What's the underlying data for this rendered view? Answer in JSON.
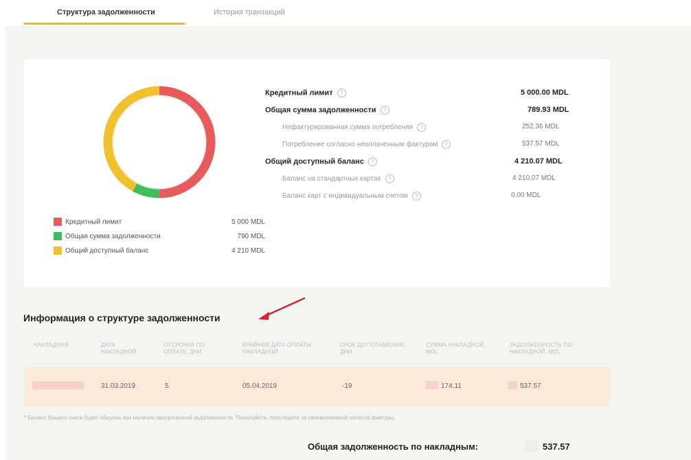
{
  "tabs": [
    {
      "label": "Структура задолженности",
      "active": true
    },
    {
      "label": "История транзакций",
      "active": false
    }
  ],
  "chart_data": {
    "type": "pie",
    "categories": [
      "Кредитный лимит",
      "Общая сумма задолженности",
      "Общий доступный баланс"
    ],
    "values": [
      5000,
      790,
      4210
    ],
    "colors": [
      "#e85b5d",
      "#3fbf5b",
      "#f0c12f"
    ]
  },
  "legend": [
    {
      "label": "Кредитный лимит",
      "value": "5 000 MDL",
      "color": "#e85b5d"
    },
    {
      "label": "Общая сумма задолженности",
      "value": "790 MDL",
      "color": "#3fbf5b"
    },
    {
      "label": "Общий доступный баланс",
      "value": "4 210 MDL",
      "color": "#f0c12f"
    }
  ],
  "summary": [
    {
      "label": "Кредитный лимит",
      "value": "5 000.00 MDL",
      "kind": "main"
    },
    {
      "label": "Общая сумма задолженности",
      "value": "789.93 MDL",
      "kind": "main"
    },
    {
      "label": "Нефактурированная сумма потребления",
      "value": "252.36 MDL",
      "kind": "sub"
    },
    {
      "label": "Потребление согласно неоплаченным фактурам",
      "value": "537.57 MDL",
      "kind": "sub"
    },
    {
      "label": "Общий доступный баланс",
      "value": "4 210.07 MDL",
      "kind": "main"
    },
    {
      "label": "Баланс на стандартных картах",
      "value": "4 210.07 MDL",
      "kind": "sub"
    },
    {
      "label": "Баланс карт с индивидуальным счетом",
      "value": "0.00 MDL",
      "kind": "sub"
    }
  ],
  "section_title": "Информация о структуре задолженности",
  "table": {
    "headers": [
      "НАКЛАДНАЯ",
      "ДАТА НАКЛАДНОЙ",
      "ОТСРОЧКА ПО ОПЛАТЕ, ДНИ",
      "КРАЙНЯЯ ДАТА ОПЛАТЫ НАКЛАДНОЙ",
      "СРОК ДО ПОГАШЕНИЯ, ДНИ",
      "СУММА НАКЛАДНОЙ, MDL",
      "ЗАДОЛЖЕННОСТЬ ПО НАКЛАДНОЙ, MDL"
    ],
    "rows": [
      {
        "invoice": "",
        "date": "31.03.2019",
        "deferral": "5",
        "due_date": "05.04.2019",
        "days_left": "-19",
        "amount": "174.11",
        "debt": "537.57"
      }
    ]
  },
  "footnote": "* Баланс Вашего счета будет обнулен при наличии просроченной задолженности. Пожалуйста, проследите за своевременной оплатой фактуры.",
  "total": {
    "label": "Общая задолженность по накладным:",
    "value": "537.57"
  }
}
